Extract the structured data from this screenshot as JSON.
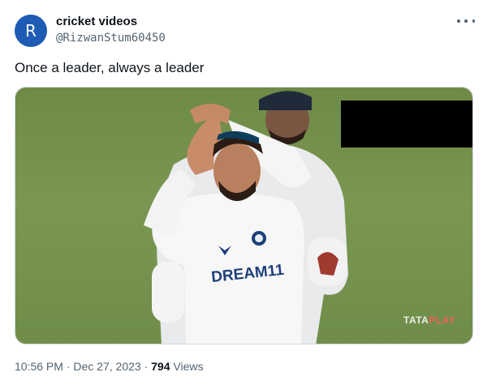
{
  "author": {
    "avatar_letter": "R",
    "display_name": "cricket videos",
    "handle": "@RizwanStum60450"
  },
  "tweet": {
    "text": "Once a leader, always a leader"
  },
  "media": {
    "jersey_text": "DREAM11",
    "watermark_part1": "TATA",
    "watermark_part2": "PLAY"
  },
  "meta": {
    "time": "10:56 PM",
    "separator": "·",
    "date": "Dec 27, 2023",
    "separator2": "·",
    "views_count": "794",
    "views_label": "Views"
  },
  "colors": {
    "avatar_bg": "#1d5bb5",
    "text_primary": "#0f1419",
    "text_secondary": "#536471",
    "border": "#cfd9de"
  },
  "icons": {
    "more": "more-horizontal-icon"
  }
}
